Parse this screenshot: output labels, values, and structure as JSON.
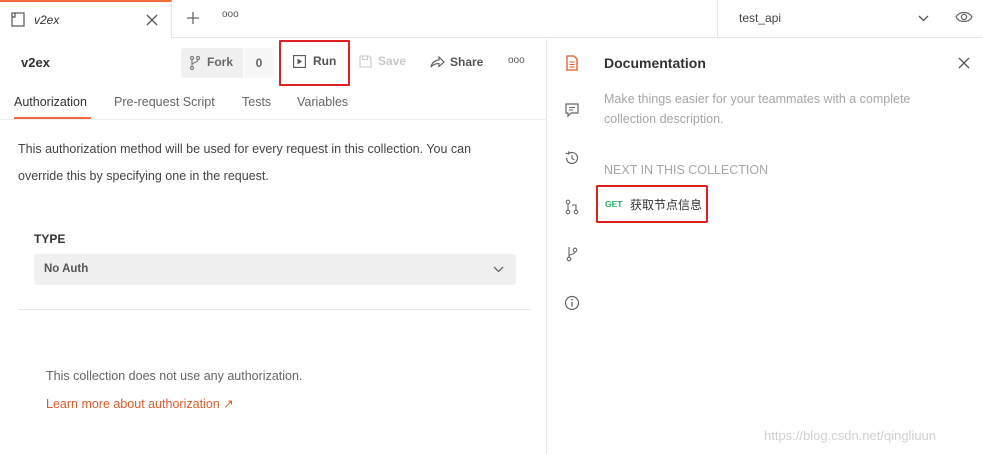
{
  "tabbar": {
    "tab_title": "v2ex",
    "environment": "test_api",
    "icons": [
      "collection-icon",
      "close-icon",
      "plus-icon",
      "more-icon",
      "chevron-down-icon",
      "eye-icon"
    ]
  },
  "collection": {
    "name": "v2ex",
    "fork_label": "Fork",
    "fork_count": "0",
    "run_label": "Run",
    "save_label": "Save",
    "share_label": "Share",
    "more_label": "ooo"
  },
  "subtabs": [
    "Authorization",
    "Pre-request Script",
    "Tests",
    "Variables"
  ],
  "auth": {
    "description": "This authorization method will be used for every request in this collection. You can override this by specifying one in the request.",
    "type_label": "TYPE",
    "type_value": "No Auth",
    "no_auth_text": "This collection does not use any authorization.",
    "learn_more": "Learn more about authorization ↗"
  },
  "rail": [
    "documentation-icon",
    "comments-icon",
    "history-icon",
    "pull-request-icon",
    "branch-icon",
    "info-icon"
  ],
  "documentation": {
    "title": "Documentation",
    "description": "Make things easier for your teammates with a complete collection description.",
    "next_label": "NEXT IN THIS COLLECTION",
    "request_method": "GET",
    "request_name": "获取节点信息"
  },
  "watermark": "https://blog.csdn.net/qingliuun",
  "colors": {
    "accent": "#f26b3a",
    "highlight_border": "#e02020",
    "get_method": "#27ae60",
    "link": "#e0592a"
  }
}
